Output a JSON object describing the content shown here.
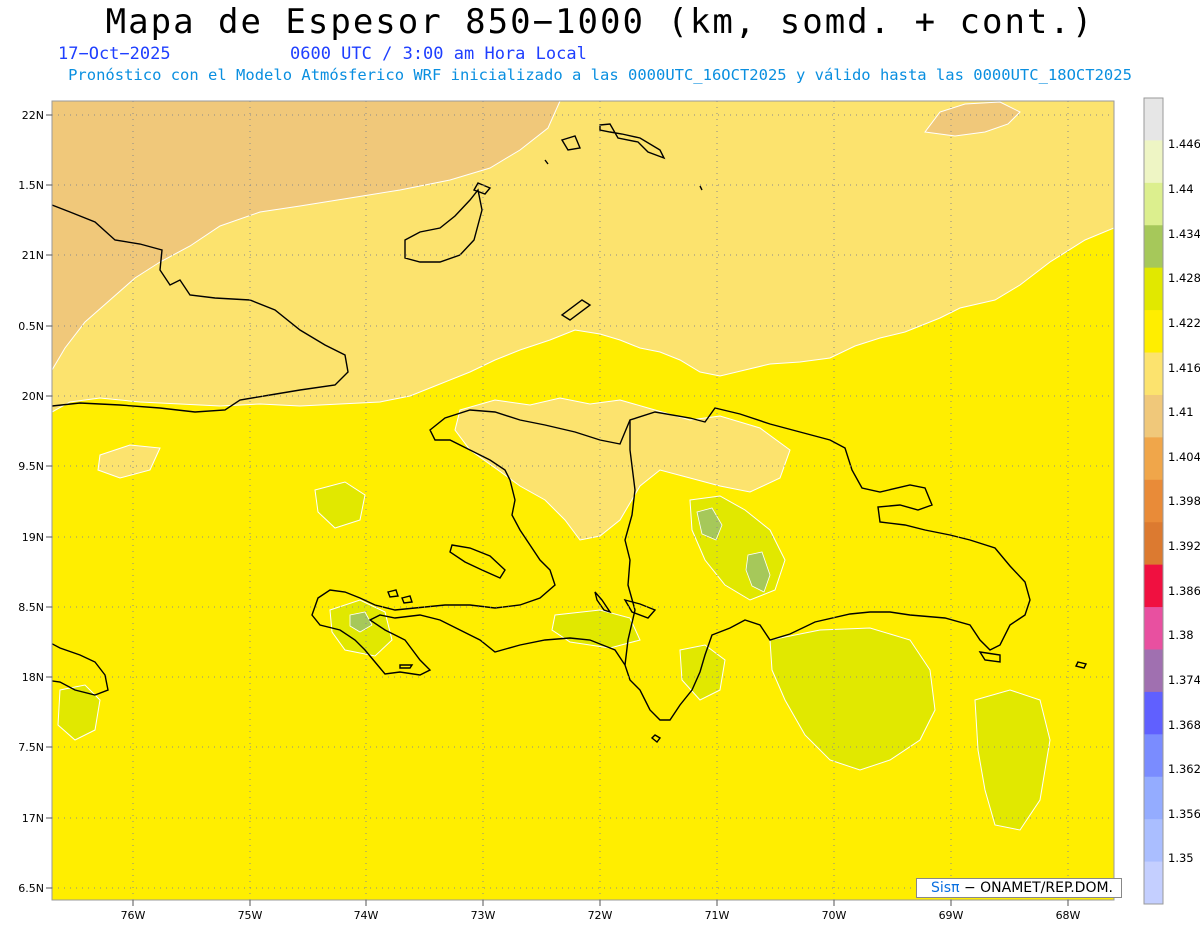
{
  "header": {
    "title": "Mapa de Espesor 850−1000 (km, somd. + cont.)",
    "date": "17−Oct−2025",
    "time": "0600 UTC / 3:00 am Hora Local",
    "forecast_note": "Pronóstico con el Modelo Atmósferico WRF inicializado a las 0000UTC_16OCT2025 y válido hasta las  0000UTC_18OCT2025"
  },
  "axes": {
    "lat_labels": [
      "22N",
      "1.5N",
      "21N",
      "0.5N",
      "20N",
      "9.5N",
      "19N",
      "8.5N",
      "18N",
      "7.5N",
      "17N",
      "6.5N"
    ],
    "lon_labels": [
      "76W",
      "75W",
      "74W",
      "73W",
      "72W",
      "71W",
      "70W",
      "69W",
      "68W"
    ]
  },
  "colorbar": {
    "labels": [
      "1.446",
      "1.44",
      "1.434",
      "1.428",
      "1.422",
      "1.416",
      "1.41",
      "1.404",
      "1.398",
      "1.392",
      "1.386",
      "1.38",
      "1.374",
      "1.368",
      "1.362",
      "1.356",
      "1.35"
    ],
    "colors": [
      "#e6e6e6",
      "#eef5c4",
      "#dcef8e",
      "#a6c85a",
      "#e1e800",
      "#ffee00",
      "#fce36e",
      "#f0c87a",
      "#f0a64a",
      "#e98b38",
      "#dc7a30",
      "#f01040",
      "#e850a0",
      "#a070b0",
      "#6060ff",
      "#7a8cff",
      "#94acff",
      "#aabeff",
      "#c4cfff"
    ]
  },
  "credit": {
    "brand": "Sisπ",
    "text": "− ONAMET/REP.DOM."
  },
  "palette": {
    "yellow": "#ffee00",
    "light_yellow": "#fce36e",
    "tan": "#f0c87a",
    "lime": "#e1e800",
    "green": "#a6c85a"
  }
}
